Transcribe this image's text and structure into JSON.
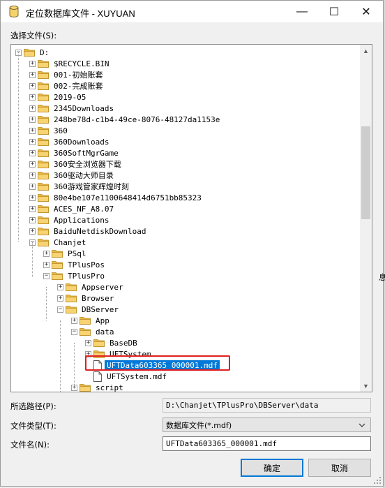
{
  "window": {
    "title": "定位数据库文件 - XUYUAN",
    "controls": {
      "minimize": "—",
      "maximize": "☐",
      "close": "✕"
    }
  },
  "select_file_label": "选择文件(S):",
  "tree": {
    "nodes": [
      {
        "label": "D:",
        "icon": "folder",
        "expander": "minus"
      },
      {
        "label": "$RECYCLE.BIN",
        "icon": "folder",
        "expander": "plus"
      },
      {
        "label": "001-初始账套",
        "icon": "folder",
        "expander": "plus"
      },
      {
        "label": "002-完成账套",
        "icon": "folder",
        "expander": "plus"
      },
      {
        "label": "2019-05",
        "icon": "folder",
        "expander": "plus"
      },
      {
        "label": "2345Downloads",
        "icon": "folder",
        "expander": "plus"
      },
      {
        "label": "248be78d-c1b4-49ce-8076-48127da1153e",
        "icon": "folder",
        "expander": "plus"
      },
      {
        "label": "360",
        "icon": "folder",
        "expander": "plus"
      },
      {
        "label": "360Downloads",
        "icon": "folder",
        "expander": "plus"
      },
      {
        "label": "360SoftMgrGame",
        "icon": "folder",
        "expander": "plus"
      },
      {
        "label": "360安全浏览器下载",
        "icon": "folder",
        "expander": "plus"
      },
      {
        "label": "360驱动大师目录",
        "icon": "folder",
        "expander": "plus"
      },
      {
        "label": "360游戏管家辉煌时刻",
        "icon": "folder",
        "expander": "plus"
      },
      {
        "label": "80e4be107e1100648414d6751bb85323",
        "icon": "folder",
        "expander": "plus"
      },
      {
        "label": "ACES_NF_A8.07",
        "icon": "folder",
        "expander": "plus"
      },
      {
        "label": "Applications",
        "icon": "folder",
        "expander": "plus"
      },
      {
        "label": "BaiduNetdiskDownload",
        "icon": "folder",
        "expander": "plus"
      },
      {
        "label": "Chanjet",
        "icon": "folder",
        "expander": "minus"
      },
      {
        "label": "PSql",
        "icon": "folder",
        "expander": "plus"
      },
      {
        "label": "TPlusPos",
        "icon": "folder",
        "expander": "plus"
      },
      {
        "label": "TPlusPro",
        "icon": "folder",
        "expander": "minus"
      },
      {
        "label": "Appserver",
        "icon": "folder",
        "expander": "plus"
      },
      {
        "label": "Browser",
        "icon": "folder",
        "expander": "plus"
      },
      {
        "label": "DBServer",
        "icon": "folder",
        "expander": "minus"
      },
      {
        "label": "App",
        "icon": "folder",
        "expander": "plus"
      },
      {
        "label": "data",
        "icon": "folder",
        "expander": "minus"
      },
      {
        "label": "BaseDB",
        "icon": "folder",
        "expander": "plus"
      },
      {
        "label": "UFTSystem",
        "icon": "folder",
        "expander": "plus"
      },
      {
        "label": "UFTData603365_000001.mdf",
        "icon": "file",
        "expander": "none",
        "selected": true
      },
      {
        "label": "UFTSystem.mdf",
        "icon": "file",
        "expander": "none"
      },
      {
        "label": "script",
        "icon": "folder",
        "expander": "plus"
      }
    ]
  },
  "path_label": "所选路径(P):",
  "path_value": "D:\\Chanjet\\TPlusPro\\DBServer\\data",
  "filetype_label": "文件类型(T):",
  "filetype_value": "数据库文件(*.mdf)",
  "filename_label": "文件名(N):",
  "filename_value": "UFTData603365_000001.mdf",
  "ok_button": "确定",
  "cancel_button": "取消",
  "background_fragment": "息",
  "colors": {
    "selection": "#0078d7",
    "highlight_box": "#e02020",
    "folder": "#f2c75c"
  }
}
